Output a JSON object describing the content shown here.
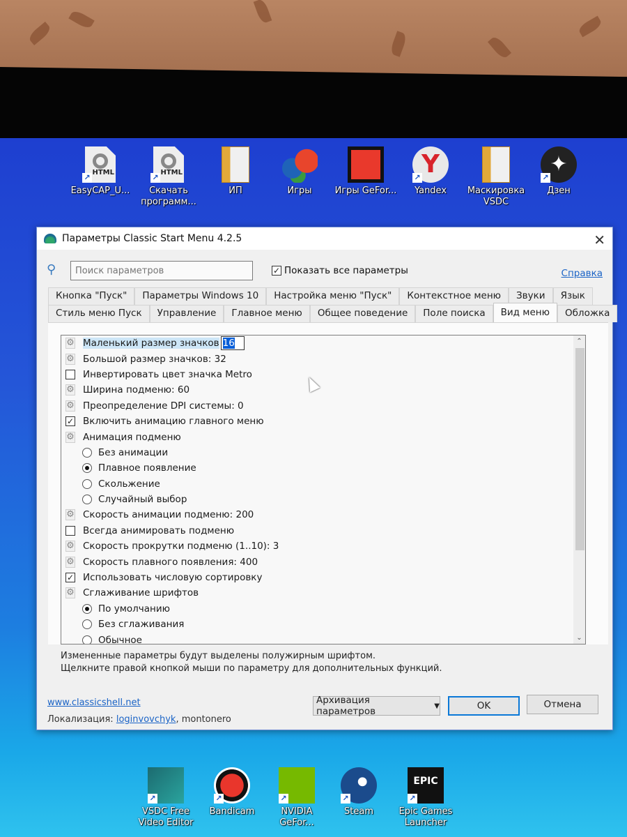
{
  "desktop_top_icons": [
    {
      "label": "EasyCAP_U...",
      "type": "html-file",
      "shortcut": true
    },
    {
      "label": "Скачать программ...",
      "type": "html-file",
      "shortcut": true
    },
    {
      "label": "ИП",
      "type": "folder",
      "shortcut": false
    },
    {
      "label": "Игры",
      "type": "msn-butterfly",
      "shortcut": false
    },
    {
      "label": "Игры GeFor...",
      "type": "game-app",
      "shortcut": false
    },
    {
      "label": "Yandex",
      "type": "yandex-browser",
      "shortcut": true
    },
    {
      "label": "Маскировка VSDC",
      "type": "folder",
      "shortcut": false
    },
    {
      "label": "Дзен",
      "type": "dzen",
      "shortcut": true
    }
  ],
  "desktop_bottom_icons": [
    {
      "label": "VSDC Free Video Editor",
      "type": "vsdc",
      "shortcut": true
    },
    {
      "label": "Bandicam",
      "type": "bandicam",
      "shortcut": true
    },
    {
      "label": "NVIDIA GeFor...",
      "type": "nvidia",
      "shortcut": true
    },
    {
      "label": "Steam",
      "type": "steam",
      "shortcut": true
    },
    {
      "label": "Epic Games Launcher",
      "type": "epic",
      "shortcut": true
    }
  ],
  "dialog": {
    "title": "Параметры Classic Start Menu 4.2.5",
    "search_placeholder": "Поиск параметров",
    "show_all_label": "Показать все параметры",
    "show_all_checked": true,
    "help_link": "Справка",
    "tabs_row1": [
      "Кнопка \"Пуск\"",
      "Параметры Windows 10",
      "Настройка меню \"Пуск\"",
      "Контекстное меню",
      "Звуки",
      "Язык"
    ],
    "tabs_row2": [
      "Стиль меню Пуск",
      "Управление",
      "Главное меню",
      "Общее поведение",
      "Поле поиска",
      "Вид меню",
      "Обложка"
    ],
    "active_tab": "Вид меню",
    "settings": [
      {
        "kind": "setting",
        "label": "Маленький размер значков",
        "edit_value": "16",
        "selected": true
      },
      {
        "kind": "setting",
        "label": "Большой размер значков: 32"
      },
      {
        "kind": "checkbox",
        "label": "Инвертировать цвет значка Metro",
        "checked": false
      },
      {
        "kind": "setting",
        "label": "Ширина подменю: 60"
      },
      {
        "kind": "setting",
        "label": "Преопределение DPI системы: 0"
      },
      {
        "kind": "checkbox",
        "label": "Включить анимацию главного меню",
        "checked": true
      },
      {
        "kind": "setting",
        "label": "Анимация подменю"
      },
      {
        "kind": "radio",
        "label": "Без анимации",
        "checked": false
      },
      {
        "kind": "radio",
        "label": "Плавное появление",
        "checked": true
      },
      {
        "kind": "radio",
        "label": "Скольжение",
        "checked": false
      },
      {
        "kind": "radio",
        "label": "Случайный выбор",
        "checked": false
      },
      {
        "kind": "setting",
        "label": "Скорость анимации подменю: 200"
      },
      {
        "kind": "checkbox",
        "label": "Всегда анимировать подменю",
        "checked": false
      },
      {
        "kind": "setting",
        "label": "Скорость прокрутки подменю (1..10): 3"
      },
      {
        "kind": "setting",
        "label": "Скорость плавного появления: 400"
      },
      {
        "kind": "checkbox",
        "label": "Использовать числовую сортировку",
        "checked": true
      },
      {
        "kind": "setting",
        "label": "Сглаживание шрифтов"
      },
      {
        "kind": "radio",
        "label": "По умолчанию",
        "checked": true
      },
      {
        "kind": "radio",
        "label": "Без сглаживания",
        "checked": false
      },
      {
        "kind": "radio",
        "label": "Обычное",
        "checked": false
      }
    ],
    "note_line1": "Измененные параметры будут выделены полужирным шрифтом.",
    "note_line2": "Щелкните правой кнопкой мыши по параметру для дополнительных функций.",
    "website_link": "www.classicshell.net",
    "localization_label": "Локализация:",
    "localization_link": "loginvovchyk",
    "localization_rest": ", montonero",
    "backup_button": "Архивация параметров",
    "ok_button": "OK",
    "cancel_button": "Отмена"
  }
}
